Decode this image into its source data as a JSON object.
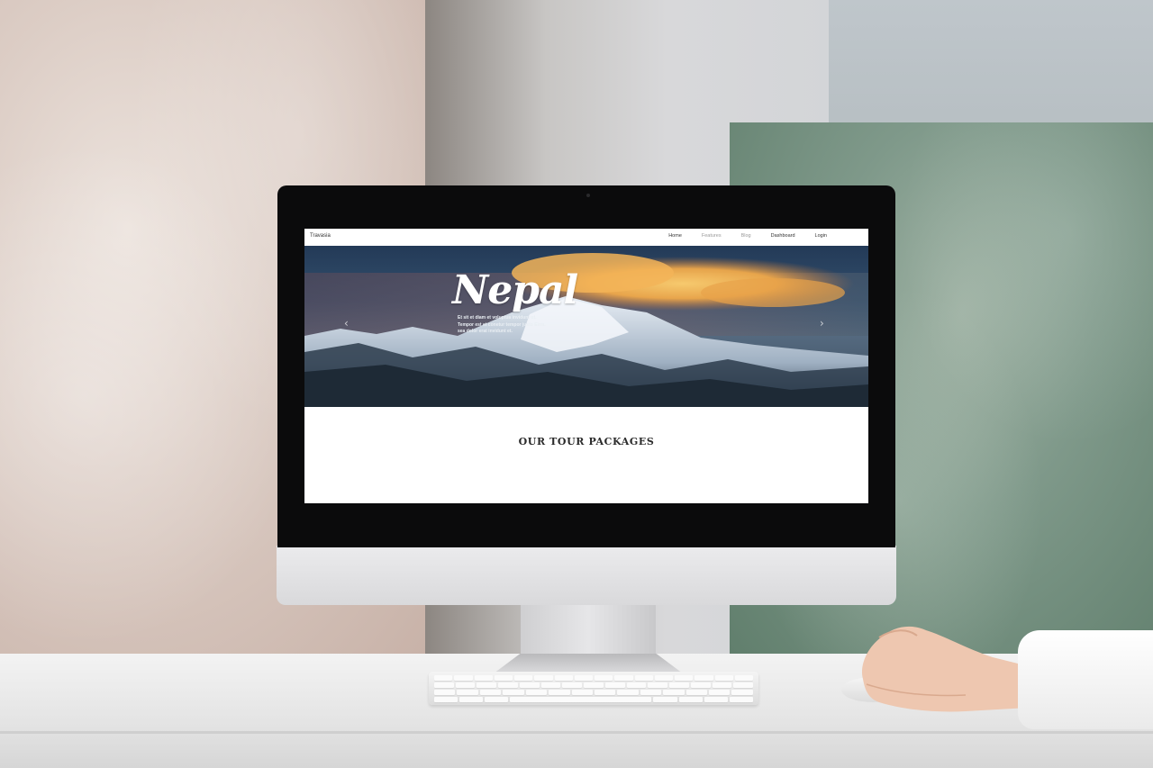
{
  "website": {
    "brand": "Travasia",
    "nav": [
      "Home",
      "Features",
      "Blog",
      "Dashboard",
      "Login"
    ],
    "hero": {
      "title": "Nepal",
      "text_lines": [
        "Et sit et diam et voluptua invidunt ut.",
        "Tempor est et conetur tempor justo Eirm.",
        "sea dolor erat invidunt et."
      ],
      "prev_arrow": "‹",
      "next_arrow": "›"
    },
    "section_title": "OUR TOUR PACKAGES"
  },
  "icons": [
    "chevron-left-icon",
    "chevron-right-icon",
    "camera-icon"
  ],
  "colors": {
    "hero_sky": "#233a57",
    "cloud_glow": "#f0a94a",
    "green_panel": "#7f998a"
  }
}
